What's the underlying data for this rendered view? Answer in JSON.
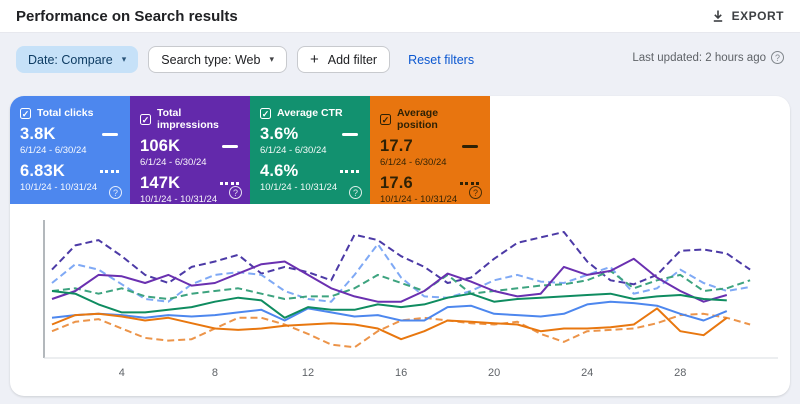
{
  "header": {
    "title": "Performance on Search results",
    "export_label": "EXPORT"
  },
  "filters": {
    "date_chip": "Date: Compare",
    "search_type_chip": "Search type: Web",
    "add_filter_label": "Add filter",
    "reset_filters_label": "Reset filters",
    "last_updated": "Last updated: 2 hours ago"
  },
  "icons": {
    "help": "?",
    "chevron": "▾",
    "plus": "+",
    "check": "✓"
  },
  "cards": [
    {
      "title": "Total clicks",
      "value1": "3.8K",
      "range1": "6/1/24 - 6/30/24",
      "value2": "6.83K",
      "range2": "10/1/24 - 10/31/24",
      "bg": "#4d87ee",
      "text": "#ffffff"
    },
    {
      "title": "Total impressions",
      "value1": "106K",
      "range1": "6/1/24 - 6/30/24",
      "value2": "147K",
      "range2": "10/1/24 - 10/31/24",
      "bg": "#6329ab",
      "text": "#ffffff"
    },
    {
      "title": "Average CTR",
      "value1": "3.6%",
      "range1": "6/1/24 - 6/30/24",
      "value2": "4.6%",
      "range2": "10/1/24 - 10/31/24",
      "bg": "#12916f",
      "text": "#ffffff"
    },
    {
      "title": "Average position",
      "value1": "17.7",
      "range1": "6/1/24 - 6/30/24",
      "value2": "17.6",
      "range2": "10/1/24 - 10/31/24",
      "bg": "#e8750f",
      "text": "#2e2105"
    }
  ],
  "chart_data": {
    "type": "line",
    "x_axis": "day of month",
    "x_range": [
      1,
      31
    ],
    "x_label_days": [
      4,
      8,
      12,
      16,
      20,
      24,
      28
    ],
    "y_axis": "unlabeled relative scale (values are percent of plot height, estimated from pixels)",
    "grid": "off",
    "legend": "shown in metric cards (solid = 6/1/24-6/30/24, dashed = 10/1/24-10/31/24)",
    "series": [
      {
        "name": "Total impressions 10/1/24 - 10/31/24",
        "metric": "impressions",
        "period": "compare",
        "style": "dashed",
        "color": "#4c3aa6",
        "values": [
          66,
          84,
          88,
          76,
          62,
          56,
          68,
          72,
          77,
          63,
          68,
          64,
          58,
          92,
          88,
          76,
          68,
          56,
          60,
          74,
          86,
          90,
          94,
          72,
          58,
          55,
          62,
          80,
          81,
          78,
          66
        ]
      },
      {
        "name": "Total clicks 10/1/24 - 10/31/24",
        "metric": "clicks",
        "period": "compare",
        "style": "dashed",
        "color": "#7fa9f5",
        "values": [
          56,
          70,
          66,
          55,
          44,
          42,
          55,
          62,
          64,
          62,
          50,
          44,
          42,
          62,
          85,
          60,
          46,
          45,
          50,
          58,
          62,
          57,
          56,
          62,
          68,
          48,
          52,
          66,
          56,
          50,
          53
        ]
      },
      {
        "name": "Average CTR 10/1/24 - 10/31/24",
        "metric": "ctr",
        "period": "compare",
        "style": "dashed",
        "color": "#3da37f",
        "values": [
          50,
          52,
          48,
          52,
          46,
          44,
          48,
          50,
          52,
          48,
          44,
          46,
          46,
          52,
          62,
          56,
          50,
          62,
          48,
          50,
          52,
          54,
          55,
          58,
          65,
          52,
          58,
          62,
          50,
          52,
          58
        ]
      },
      {
        "name": "Average position 10/1/24 - 10/31/24",
        "metric": "position",
        "period": "compare",
        "style": "dashed",
        "color": "#ec9449",
        "values": [
          20,
          27,
          29,
          22,
          15,
          13,
          14,
          22,
          30,
          30,
          25,
          18,
          10,
          8,
          20,
          28,
          30,
          28,
          26,
          25,
          27,
          18,
          12,
          20,
          21,
          22,
          26,
          32,
          33,
          30,
          25
        ]
      },
      {
        "name": "Total impressions 6/1/24 - 6/30/24",
        "metric": "impressions",
        "period": "current",
        "style": "solid",
        "color": "#6a30b0",
        "values": [
          44,
          50,
          62,
          61,
          56,
          62,
          54,
          56,
          63,
          70,
          72,
          62,
          52,
          46,
          42,
          42,
          50,
          63,
          57,
          50,
          46,
          48,
          68,
          62,
          65,
          74,
          60,
          50,
          42,
          47
        ]
      },
      {
        "name": "Total clicks 6/1/24 - 6/30/24",
        "metric": "clicks",
        "period": "current",
        "style": "solid",
        "color": "#4d87ee",
        "values": [
          30,
          32,
          33,
          32,
          30,
          32,
          31,
          32,
          34,
          36,
          28,
          37,
          34,
          31,
          32,
          28,
          28,
          38,
          39,
          33,
          32,
          31,
          33,
          40,
          42,
          41,
          39,
          33,
          28,
          35
        ]
      },
      {
        "name": "Average CTR 6/1/24 - 6/30/24",
        "metric": "ctr",
        "period": "current",
        "style": "solid",
        "color": "#0f8c60",
        "values": [
          50,
          48,
          40,
          34,
          34,
          36,
          38,
          42,
          45,
          43,
          30,
          38,
          36,
          36,
          40,
          38,
          40,
          45,
          48,
          42,
          44,
          45,
          46,
          47,
          48,
          44,
          46,
          47,
          44,
          43
        ]
      },
      {
        "name": "Average position 6/1/24 - 6/30/24",
        "metric": "position",
        "period": "current",
        "style": "solid",
        "color": "#e8770f",
        "values": [
          25,
          32,
          33,
          31,
          28,
          30,
          26,
          22,
          21,
          22,
          24,
          25,
          26,
          25,
          22,
          14,
          20,
          28,
          27,
          26,
          25,
          20,
          22,
          22,
          23,
          25,
          37,
          20,
          17,
          30
        ]
      }
    ],
    "axis_colors": {
      "y_axis_line": "#9aa0a6",
      "x_axis_line": "#dadce0",
      "tick_label": "#5f6368"
    }
  }
}
